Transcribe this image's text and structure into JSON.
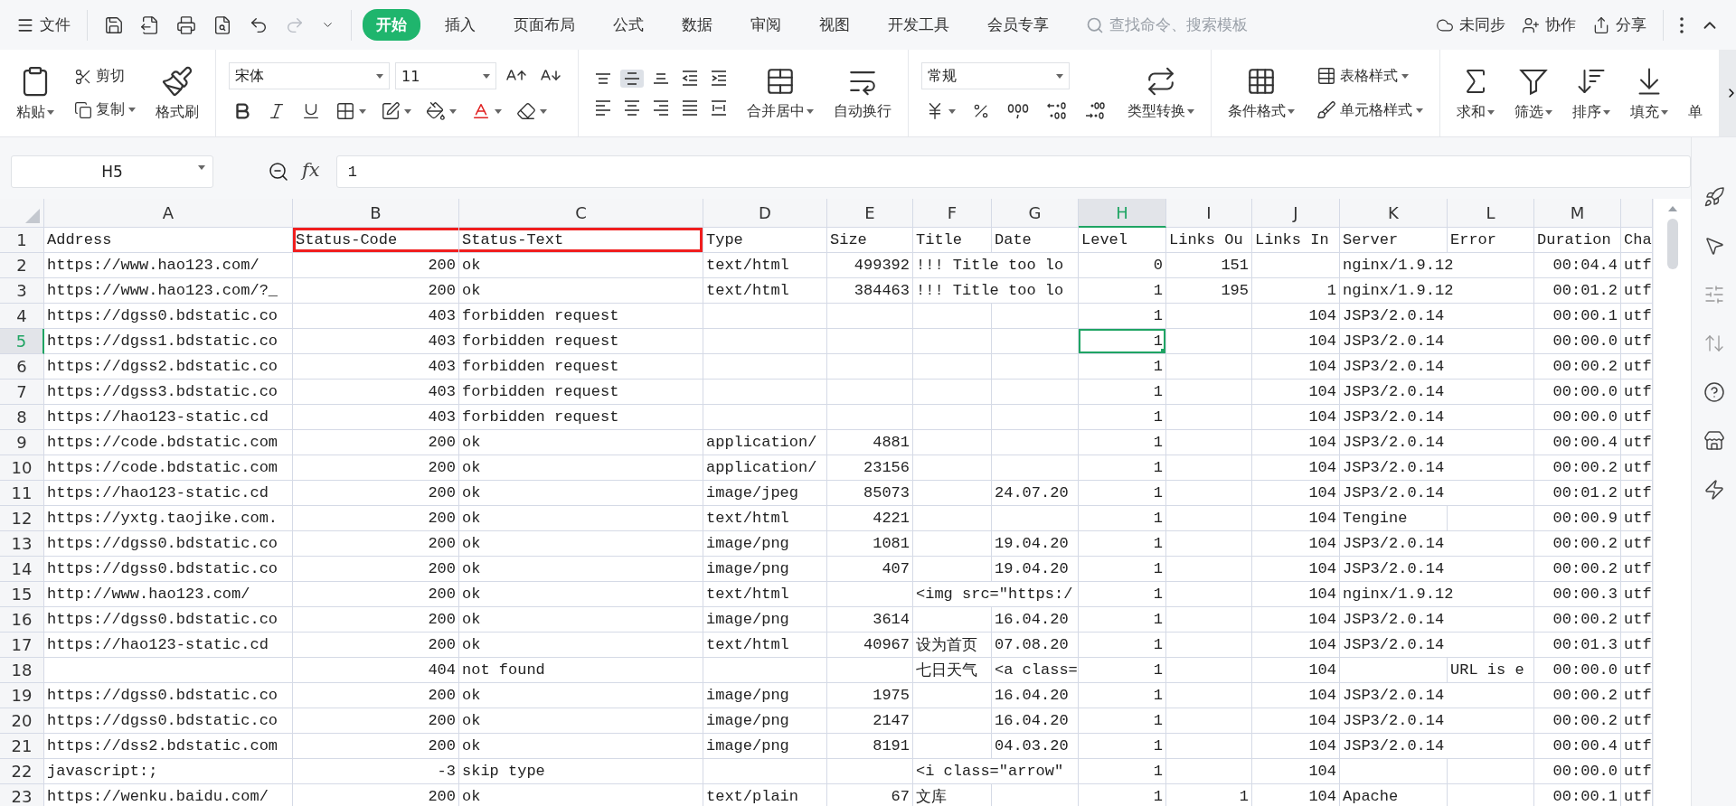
{
  "menu": {
    "label": "文件"
  },
  "quick_access": [
    {
      "kind": "save",
      "disabled": false
    },
    {
      "kind": "export",
      "disabled": false
    },
    {
      "kind": "print",
      "disabled": false
    },
    {
      "kind": "preview",
      "disabled": false
    },
    {
      "kind": "undo",
      "disabled": false
    },
    {
      "kind": "redo",
      "disabled": true
    },
    {
      "kind": "more",
      "disabled": false
    }
  ],
  "tabs": [
    {
      "label": "开始",
      "selected": true
    },
    {
      "label": "插入",
      "selected": false
    },
    {
      "label": "页面布局",
      "selected": false
    },
    {
      "label": "公式",
      "selected": false
    },
    {
      "label": "数据",
      "selected": false
    },
    {
      "label": "审阅",
      "selected": false
    },
    {
      "label": "视图",
      "selected": false
    },
    {
      "label": "开发工具",
      "selected": false
    },
    {
      "label": "会员专享",
      "selected": false
    }
  ],
  "search": {
    "placeholder": "查找命令、搜索模板"
  },
  "account_actions": [
    {
      "kind": "sync",
      "label": "未同步"
    },
    {
      "kind": "collaborate",
      "label": "协作"
    },
    {
      "kind": "share",
      "label": "分享"
    }
  ],
  "ribbon": {
    "clipboard": {
      "paste": "粘贴",
      "cut": "剪切",
      "copy": "复制",
      "format_painter": "格式刷"
    },
    "font": {
      "name": "宋体",
      "size": "11"
    },
    "alignment": [
      {
        "kind": "top",
        "selected": false
      },
      {
        "kind": "middle",
        "selected": true
      },
      {
        "kind": "bottom",
        "selected": false
      },
      {
        "kind": "outdent",
        "selected": false
      },
      {
        "kind": "indent",
        "selected": false
      },
      {
        "kind": "left",
        "selected": false
      },
      {
        "kind": "center",
        "selected": false
      },
      {
        "kind": "right",
        "selected": false
      },
      {
        "kind": "justify",
        "selected": false
      },
      {
        "kind": "distributed",
        "selected": false
      }
    ],
    "merge": "合并居中",
    "wrap": "自动换行",
    "number": {
      "format": "常规",
      "convert": "类型转换"
    },
    "styles": {
      "conditional": "条件格式",
      "table_style": "表格样式",
      "cell_style": "单元格样式"
    },
    "editing": [
      {
        "kind": "sum",
        "label": "求和"
      },
      {
        "kind": "filter",
        "label": "筛选"
      },
      {
        "kind": "sort",
        "label": "排序"
      },
      {
        "kind": "fill",
        "label": "填充"
      },
      {
        "kind": "cut",
        "label": "单"
      }
    ]
  },
  "formula_bar": {
    "cell": "H5",
    "function_label": "fx",
    "value": "1"
  },
  "sheet": {
    "columns": [
      {
        "letter": "A",
        "kind": "text",
        "selected": false
      },
      {
        "letter": "B",
        "kind": "number",
        "selected": false
      },
      {
        "letter": "C",
        "kind": "text",
        "selected": false
      },
      {
        "letter": "D",
        "kind": "text",
        "selected": false
      },
      {
        "letter": "E",
        "kind": "number",
        "selected": false
      },
      {
        "letter": "F",
        "kind": "text",
        "selected": false
      },
      {
        "letter": "G",
        "kind": "text",
        "selected": false
      },
      {
        "letter": "H",
        "kind": "number",
        "selected": true
      },
      {
        "letter": "I",
        "kind": "number",
        "selected": false
      },
      {
        "letter": "J",
        "kind": "number",
        "selected": false
      },
      {
        "letter": "K",
        "kind": "text",
        "selected": false
      },
      {
        "letter": "L",
        "kind": "text",
        "selected": false
      },
      {
        "letter": "M",
        "kind": "number",
        "selected": false
      },
      {
        "kind": "text",
        "selected": false
      }
    ],
    "rows": [
      {
        "number": "1",
        "kind": "header",
        "selected": false,
        "cells": [
          {
            "text": "Address",
            "marked": false
          },
          {
            "text": "Status-Code",
            "marked": true
          },
          {
            "text": "Status-Text",
            "marked": true
          },
          {
            "text": "Type",
            "marked": false
          },
          {
            "text": "Size",
            "marked": false
          },
          {
            "text": "Title",
            "marked": false
          },
          {
            "text": "Date",
            "marked": false
          },
          {
            "text": "Level",
            "marked": false
          },
          {
            "text": "Links Ou",
            "marked": false
          },
          {
            "text": "Links In",
            "marked": false
          },
          {
            "text": "Server",
            "marked": false
          },
          {
            "text": "Error",
            "marked": false
          },
          {
            "text": "Duration",
            "marked": false
          },
          {
            "text": "Cha",
            "marked": false
          }
        ]
      },
      {
        "number": "2",
        "selected": false,
        "cells": [
          {
            "text": "https://www.hao123.com/"
          },
          {
            "text": "200"
          },
          {
            "text": "ok"
          },
          {
            "text": "text/html"
          },
          {
            "text": "499392"
          },
          {
            "text": "!!! Title too lo"
          },
          null,
          {
            "text": "0"
          },
          {
            "text": "151"
          },
          null,
          {
            "text": "nginx/1.9.12"
          },
          null,
          {
            "text": "00:04.4"
          },
          {
            "text": "utf"
          }
        ]
      },
      {
        "number": "3",
        "selected": false,
        "cells": [
          {
            "text": "https://www.hao123.com/?_"
          },
          {
            "text": "200"
          },
          {
            "text": "ok"
          },
          {
            "text": "text/html"
          },
          {
            "text": "384463"
          },
          {
            "text": "!!! Title too lo"
          },
          null,
          {
            "text": "1"
          },
          {
            "text": "195"
          },
          {
            "text": "1"
          },
          {
            "text": "nginx/1.9.12"
          },
          null,
          {
            "text": "00:01.2"
          },
          {
            "text": "utf"
          }
        ]
      },
      {
        "number": "4",
        "selected": false,
        "cells": [
          {
            "text": "https://dgss0.bdstatic.co"
          },
          {
            "text": "403"
          },
          {
            "text": "forbidden request"
          },
          null,
          null,
          null,
          null,
          {
            "text": "1"
          },
          null,
          {
            "text": "104"
          },
          {
            "text": "JSP3/2.0.14"
          },
          null,
          {
            "text": "00:00.1"
          },
          {
            "text": "utf"
          }
        ]
      },
      {
        "number": "5",
        "selected": true,
        "cells": [
          {
            "text": "https://dgss1.bdstatic.co"
          },
          {
            "text": "403"
          },
          {
            "text": "forbidden request"
          },
          null,
          null,
          null,
          null,
          {
            "text": "1"
          },
          null,
          {
            "text": "104"
          },
          {
            "text": "JSP3/2.0.14"
          },
          null,
          {
            "text": "00:00.0"
          },
          {
            "text": "utf"
          }
        ]
      },
      {
        "number": "6",
        "selected": false,
        "cells": [
          {
            "text": "https://dgss2.bdstatic.co"
          },
          {
            "text": "403"
          },
          {
            "text": "forbidden request"
          },
          null,
          null,
          null,
          null,
          {
            "text": "1"
          },
          null,
          {
            "text": "104"
          },
          {
            "text": "JSP3/2.0.14"
          },
          null,
          {
            "text": "00:00.2"
          },
          {
            "text": "utf"
          }
        ]
      },
      {
        "number": "7",
        "selected": false,
        "cells": [
          {
            "text": "https://dgss3.bdstatic.co"
          },
          {
            "text": "403"
          },
          {
            "text": "forbidden request"
          },
          null,
          null,
          null,
          null,
          {
            "text": "1"
          },
          null,
          {
            "text": "104"
          },
          {
            "text": "JSP3/2.0.14"
          },
          null,
          {
            "text": "00:00.0"
          },
          {
            "text": "utf"
          }
        ]
      },
      {
        "number": "8",
        "selected": false,
        "cells": [
          {
            "text": "https://hao123-static.cd"
          },
          {
            "text": "403"
          },
          {
            "text": "forbidden request"
          },
          null,
          null,
          null,
          null,
          {
            "text": "1"
          },
          null,
          {
            "text": "104"
          },
          {
            "text": "JSP3/2.0.14"
          },
          null,
          {
            "text": "00:00.0"
          },
          {
            "text": "utf"
          }
        ]
      },
      {
        "number": "9",
        "selected": false,
        "cells": [
          {
            "text": "https://code.bdstatic.com"
          },
          {
            "text": "200"
          },
          {
            "text": "ok"
          },
          {
            "text": "application/"
          },
          {
            "text": "4881"
          },
          null,
          null,
          {
            "text": "1"
          },
          null,
          {
            "text": "104"
          },
          {
            "text": "JSP3/2.0.14"
          },
          null,
          {
            "text": "00:00.4"
          },
          {
            "text": "utf"
          }
        ]
      },
      {
        "number": "10",
        "selected": false,
        "cells": [
          {
            "text": "https://code.bdstatic.com"
          },
          {
            "text": "200"
          },
          {
            "text": "ok"
          },
          {
            "text": "application/"
          },
          {
            "text": "23156"
          },
          null,
          null,
          {
            "text": "1"
          },
          null,
          {
            "text": "104"
          },
          {
            "text": "JSP3/2.0.14"
          },
          null,
          {
            "text": "00:00.2"
          },
          {
            "text": "utf"
          }
        ]
      },
      {
        "number": "11",
        "selected": false,
        "cells": [
          {
            "text": "https://hao123-static.cd"
          },
          {
            "text": "200"
          },
          {
            "text": "ok"
          },
          {
            "text": "image/jpeg"
          },
          {
            "text": "85073"
          },
          null,
          {
            "text": "24.07.20"
          },
          {
            "text": "1"
          },
          null,
          {
            "text": "104"
          },
          {
            "text": "JSP3/2.0.14"
          },
          null,
          {
            "text": "00:01.2"
          },
          {
            "text": "utf"
          }
        ]
      },
      {
        "number": "12",
        "selected": false,
        "cells": [
          {
            "text": "https://yxtg.taojike.com."
          },
          {
            "text": "200"
          },
          {
            "text": "ok"
          },
          {
            "text": "text/html"
          },
          {
            "text": "4221"
          },
          null,
          null,
          {
            "text": "1"
          },
          null,
          {
            "text": "104"
          },
          {
            "text": "Tengine"
          },
          null,
          {
            "text": "00:00.9"
          },
          {
            "text": "utf"
          }
        ]
      },
      {
        "number": "13",
        "selected": false,
        "cells": [
          {
            "text": "https://dgss0.bdstatic.co"
          },
          {
            "text": "200"
          },
          {
            "text": "ok"
          },
          {
            "text": "image/png"
          },
          {
            "text": "1081"
          },
          null,
          {
            "text": "19.04.20"
          },
          {
            "text": "1"
          },
          null,
          {
            "text": "104"
          },
          {
            "text": "JSP3/2.0.14"
          },
          null,
          {
            "text": "00:00.2"
          },
          {
            "text": "utf"
          }
        ]
      },
      {
        "number": "14",
        "selected": false,
        "cells": [
          {
            "text": "https://dgss0.bdstatic.co"
          },
          {
            "text": "200"
          },
          {
            "text": "ok"
          },
          {
            "text": "image/png"
          },
          {
            "text": "407"
          },
          null,
          {
            "text": "19.04.20"
          },
          {
            "text": "1"
          },
          null,
          {
            "text": "104"
          },
          {
            "text": "JSP3/2.0.14"
          },
          null,
          {
            "text": "00:00.2"
          },
          {
            "text": "utf"
          }
        ]
      },
      {
        "number": "15",
        "selected": false,
        "cells": [
          {
            "text": "http://www.hao123.com/"
          },
          {
            "text": "200"
          },
          {
            "text": "ok"
          },
          {
            "text": "text/html"
          },
          null,
          {
            "text": "<img src=\"https:/"
          },
          null,
          {
            "text": "1"
          },
          null,
          {
            "text": "104"
          },
          {
            "text": "nginx/1.9.12"
          },
          null,
          {
            "text": "00:00.3"
          },
          {
            "text": "utf"
          }
        ]
      },
      {
        "number": "16",
        "selected": false,
        "cells": [
          {
            "text": "https://dgss0.bdstatic.co"
          },
          {
            "text": "200"
          },
          {
            "text": "ok"
          },
          {
            "text": "image/png"
          },
          {
            "text": "3614"
          },
          null,
          {
            "text": "16.04.20"
          },
          {
            "text": "1"
          },
          null,
          {
            "text": "104"
          },
          {
            "text": "JSP3/2.0.14"
          },
          null,
          {
            "text": "00:00.2"
          },
          {
            "text": "utf"
          }
        ]
      },
      {
        "number": "17",
        "selected": false,
        "cells": [
          {
            "text": "https://hao123-static.cd"
          },
          {
            "text": "200"
          },
          {
            "text": "ok"
          },
          {
            "text": "text/html"
          },
          {
            "text": "40967"
          },
          {
            "text": "设为首页"
          },
          {
            "text": "07.08.20"
          },
          {
            "text": "1"
          },
          null,
          {
            "text": "104"
          },
          {
            "text": "JSP3/2.0.14"
          },
          null,
          {
            "text": "00:01.3"
          },
          {
            "text": "utf"
          }
        ]
      },
      {
        "number": "18",
        "selected": false,
        "cells": [
          null,
          {
            "text": "404"
          },
          {
            "text": "not found"
          },
          null,
          null,
          {
            "text": "七日天气"
          },
          {
            "text": "<a class="
          },
          {
            "text": "1"
          },
          null,
          {
            "text": "104"
          },
          null,
          {
            "text": "URL is e"
          },
          {
            "text": "00:00.0"
          },
          {
            "text": "utf"
          }
        ]
      },
      {
        "number": "19",
        "selected": false,
        "cells": [
          {
            "text": "https://dgss0.bdstatic.co"
          },
          {
            "text": "200"
          },
          {
            "text": "ok"
          },
          {
            "text": "image/png"
          },
          {
            "text": "1975"
          },
          null,
          {
            "text": "16.04.20"
          },
          {
            "text": "1"
          },
          null,
          {
            "text": "104"
          },
          {
            "text": "JSP3/2.0.14"
          },
          null,
          {
            "text": "00:00.2"
          },
          {
            "text": "utf"
          }
        ]
      },
      {
        "number": "20",
        "selected": false,
        "cells": [
          {
            "text": "https://dgss0.bdstatic.co"
          },
          {
            "text": "200"
          },
          {
            "text": "ok"
          },
          {
            "text": "image/png"
          },
          {
            "text": "2147"
          },
          null,
          {
            "text": "16.04.20"
          },
          {
            "text": "1"
          },
          null,
          {
            "text": "104"
          },
          {
            "text": "JSP3/2.0.14"
          },
          null,
          {
            "text": "00:00.2"
          },
          {
            "text": "utf"
          }
        ]
      },
      {
        "number": "21",
        "selected": false,
        "cells": [
          {
            "text": "https://dss2.bdstatic.com"
          },
          {
            "text": "200"
          },
          {
            "text": "ok"
          },
          {
            "text": "image/png"
          },
          {
            "text": "8191"
          },
          null,
          {
            "text": "04.03.20"
          },
          {
            "text": "1"
          },
          null,
          {
            "text": "104"
          },
          {
            "text": "JSP3/2.0.14"
          },
          null,
          {
            "text": "00:00.4"
          },
          {
            "text": "utf"
          }
        ]
      },
      {
        "number": "22",
        "selected": false,
        "cells": [
          {
            "text": "javascript:;"
          },
          {
            "text": "-3"
          },
          {
            "text": "skip type"
          },
          null,
          null,
          {
            "text": "<i class=\"arrow\""
          },
          null,
          {
            "text": "1"
          },
          null,
          {
            "text": "104"
          },
          null,
          null,
          {
            "text": "00:00.0"
          },
          {
            "text": "utf"
          }
        ]
      },
      {
        "number": "23",
        "selected": false,
        "cells": [
          {
            "text": "https://wenku.baidu.com/"
          },
          {
            "text": "200"
          },
          {
            "text": "ok"
          },
          {
            "text": "text/plain"
          },
          {
            "text": "67"
          },
          {
            "text": "文库"
          },
          null,
          {
            "text": "1"
          },
          {
            "text": "1"
          },
          {
            "text": "104"
          },
          {
            "text": "Apache"
          },
          null,
          {
            "text": "00:00.1"
          },
          {
            "text": "utf"
          }
        ]
      }
    ]
  }
}
